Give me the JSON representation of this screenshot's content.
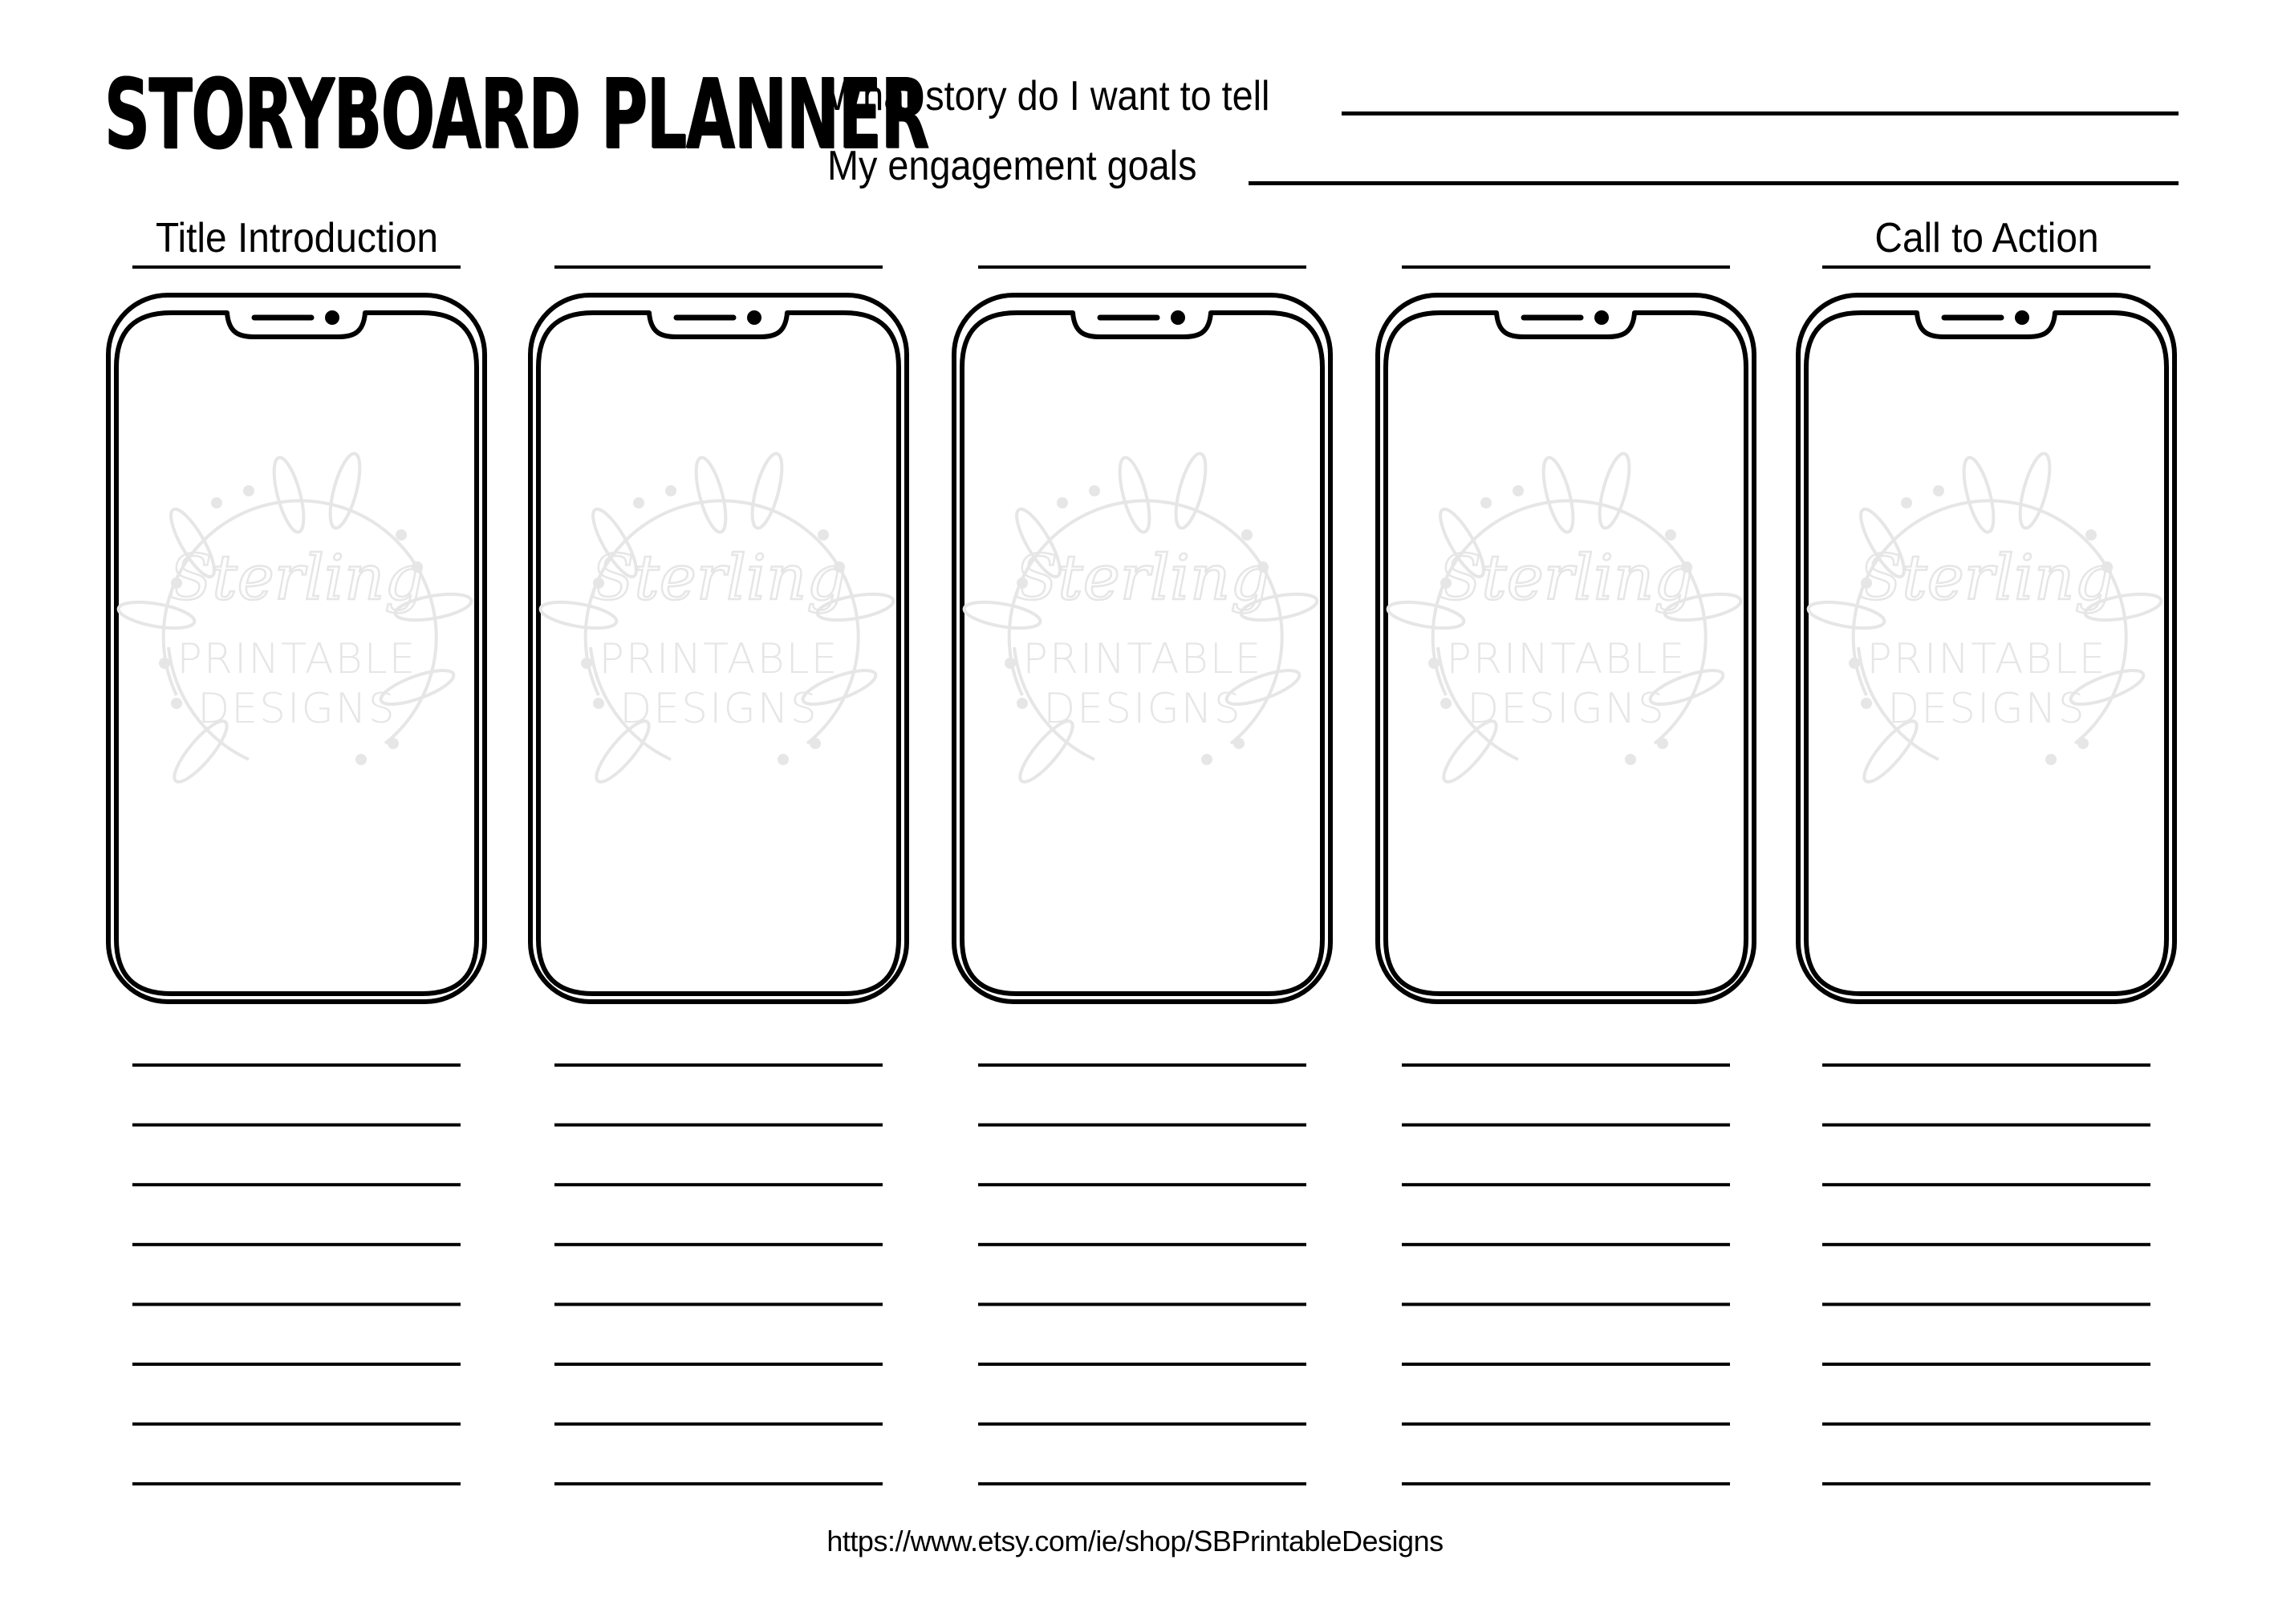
{
  "header": {
    "title": "STORYBOARD PLANNER",
    "prompts": [
      {
        "label": "What story do I want to tell",
        "value": ""
      },
      {
        "label": "My engagement goals",
        "value": ""
      }
    ]
  },
  "columns": [
    {
      "heading": "Title Introduction",
      "note_lines": 8
    },
    {
      "heading": "",
      "note_lines": 8
    },
    {
      "heading": "",
      "note_lines": 8
    },
    {
      "heading": "",
      "note_lines": 8
    },
    {
      "heading": "Call to Action",
      "note_lines": 8
    }
  ],
  "watermark": {
    "script": "Sterling",
    "line1": "PRINTABLE",
    "line2": "DESIGNS",
    "color": "#e6e6e6"
  },
  "icons": {
    "phone_frame": "smartphone-outline-icon",
    "wreath": "laurel-wreath-icon"
  },
  "colors": {
    "ink": "#000000",
    "paper": "#ffffff"
  },
  "footer": {
    "url": "https://www.etsy.com/ie/shop/SBPrintableDesigns"
  }
}
